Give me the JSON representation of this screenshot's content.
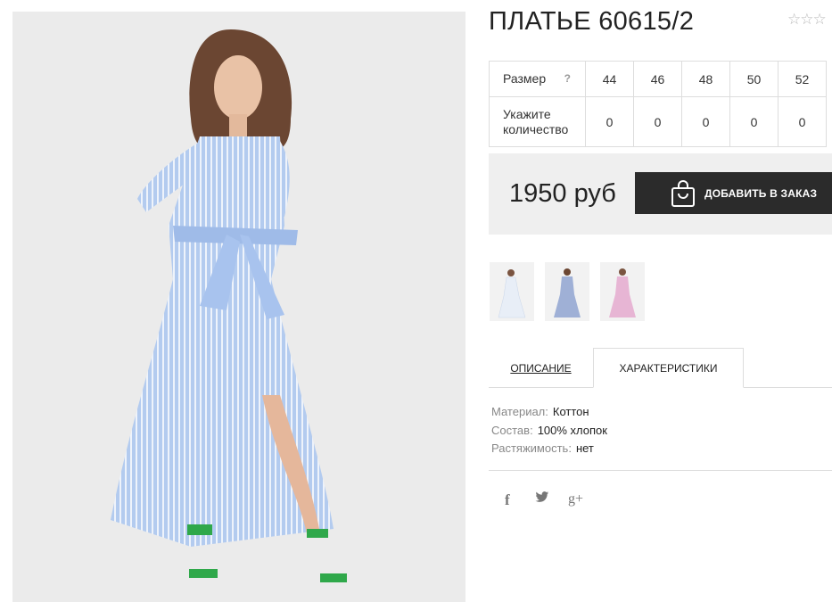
{
  "product": {
    "title": "ПЛАТЬЕ 60615/2",
    "rating_stars": "☆☆☆",
    "main_photo_alt": "model-in-striped-shirt-dress"
  },
  "size_table": {
    "size_label": "Размер",
    "help_mark": "?",
    "sizes": [
      "44",
      "46",
      "48",
      "50",
      "52"
    ],
    "quantity_label_line1": "Укажите",
    "quantity_label_line2": "количество",
    "quantities": [
      "0",
      "0",
      "0",
      "0",
      "0"
    ]
  },
  "price": {
    "amount": "1950 руб",
    "order_button_label": "ДОБАВИТЬ В ЗАКАЗ"
  },
  "thumbnails": [
    {
      "color_name": "white-blue",
      "dress_color": "#e8eef7"
    },
    {
      "color_name": "blue-striped",
      "dress_color": "#9fb0d6"
    },
    {
      "color_name": "pink",
      "dress_color": "#e7b5d4"
    }
  ],
  "tabs": {
    "description": "ОПИСАНИЕ",
    "characteristics": "ХАРАКТЕРИСТИКИ",
    "active": "characteristics"
  },
  "characteristics": [
    {
      "key": "Материал:",
      "value": "Коттон"
    },
    {
      "key": "Состав:",
      "value": "100% хлопок"
    },
    {
      "key": "Растяжимость:",
      "value": "нет"
    }
  ],
  "social": {
    "facebook": "f",
    "twitter": "twitter-icon",
    "googleplus": "g+"
  },
  "colors": {
    "button_bg": "#2b2b2b",
    "price_bg": "#efefef",
    "dress_blue": "#a9c4ec",
    "sandal_green": "#2fa84a"
  }
}
